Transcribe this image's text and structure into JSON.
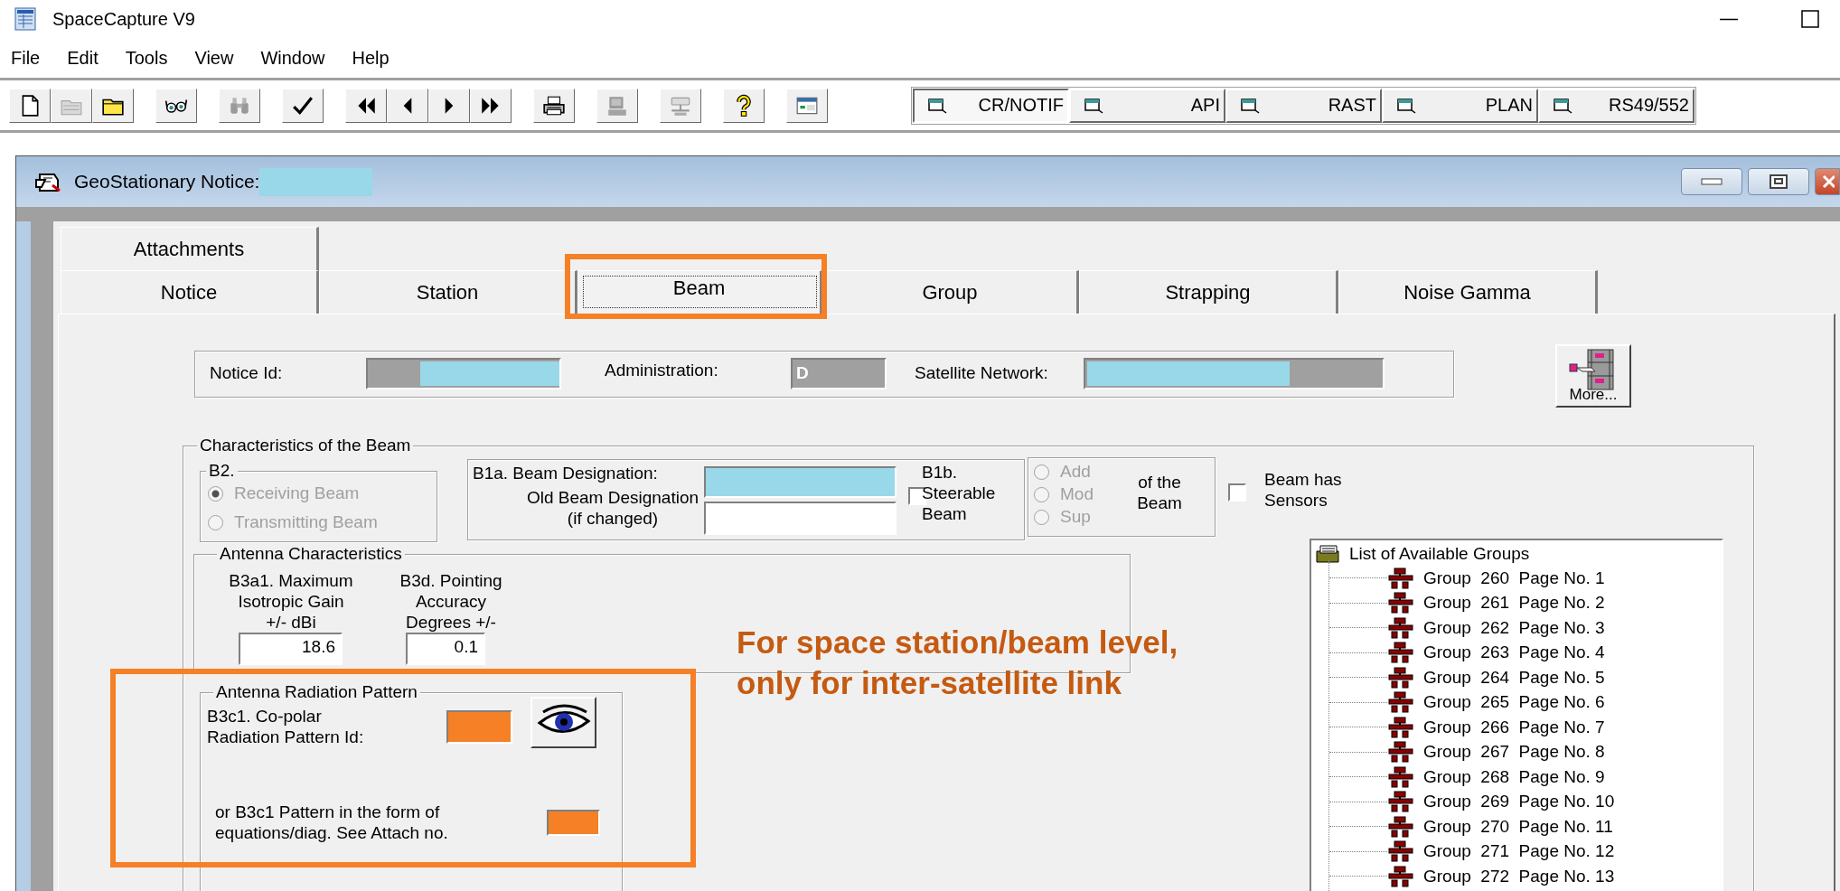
{
  "app": {
    "title": "SpaceCapture V9"
  },
  "menu": [
    {
      "label": "File"
    },
    {
      "label": "Edit"
    },
    {
      "label": "Tools"
    },
    {
      "label": "View"
    },
    {
      "label": "Window"
    },
    {
      "label": "Help"
    }
  ],
  "toolbar": {
    "groups": [
      [
        {
          "kind": "new",
          "disabled": false
        },
        {
          "kind": "open",
          "disabled": true
        },
        {
          "kind": "folder",
          "disabled": false
        }
      ],
      [
        {
          "kind": "glasses",
          "disabled": false
        }
      ],
      [
        {
          "kind": "binoculars",
          "disabled": true
        }
      ],
      [
        {
          "kind": "check",
          "disabled": false
        }
      ],
      [
        {
          "kind": "first",
          "disabled": false
        },
        {
          "kind": "previous",
          "disabled": false
        },
        {
          "kind": "next",
          "disabled": false
        },
        {
          "kind": "last",
          "disabled": false
        }
      ],
      [
        {
          "kind": "print",
          "disabled": false
        }
      ],
      [
        {
          "kind": "computer",
          "disabled": true
        }
      ],
      [
        {
          "kind": "network",
          "disabled": true
        }
      ],
      [
        {
          "kind": "help",
          "disabled": false
        }
      ],
      [
        {
          "kind": "window",
          "disabled": false
        }
      ]
    ]
  },
  "modules": [
    {
      "label": "CR/NOTIF",
      "selected": true
    },
    {
      "label": "API",
      "selected": false
    },
    {
      "label": "RAST",
      "selected": false
    },
    {
      "label": "PLAN",
      "selected": false
    },
    {
      "label": "RS49/552",
      "selected": false
    }
  ],
  "notice_window": {
    "title": "GeoStationary Notice:",
    "title_redacted": true
  },
  "tabs": [
    [
      {
        "label": "Attachments",
        "selected": false
      }
    ],
    [
      {
        "label": "Notice",
        "selected": false
      },
      {
        "label": "Station",
        "selected": false
      },
      {
        "label": "Beam",
        "selected": true
      },
      {
        "label": "Group",
        "selected": false
      },
      {
        "label": "Strapping",
        "selected": false
      },
      {
        "label": "Noise Gamma",
        "selected": false
      }
    ]
  ],
  "header": {
    "notice_id": {
      "label": "Notice Id:",
      "redacted": true
    },
    "administration": {
      "label": "Administration:",
      "value": "D"
    },
    "satellite_network": {
      "label": "Satellite Network:",
      "redacted": true
    },
    "more_button": "More..."
  },
  "beam": {
    "title": "Characteristics of the Beam",
    "b2": {
      "title": "B2.",
      "disabled": true,
      "options": [
        {
          "label": "Receiving Beam",
          "selected": true
        },
        {
          "label": "Transmitting Beam",
          "selected": false
        }
      ]
    },
    "designation": {
      "label": "B1a. Beam Designation:",
      "redacted": true,
      "old_label": [
        "Old Beam Designation",
        "(if changed)"
      ]
    },
    "steerable": {
      "label": [
        "B1b.",
        "Steerable",
        "Beam"
      ],
      "checked": false
    },
    "action": {
      "disabled": true,
      "options": [
        {
          "label": "Add",
          "selected": false
        },
        {
          "label": "Mod",
          "selected": false
        },
        {
          "label": "Sup",
          "selected": false
        }
      ],
      "label": [
        "of the",
        "Beam"
      ]
    },
    "sensors": {
      "label": [
        "Beam has",
        "Sensors"
      ],
      "checked": false
    },
    "antenna": {
      "title": "Antenna Characteristics",
      "fields": [
        {
          "label": [
            "B3a1. Maximum",
            "Isotropic Gain",
            "+/-  dBi"
          ],
          "value": "18.6"
        },
        {
          "label": [
            "B3d. Pointing",
            "Accuracy",
            "Degrees +/-"
          ],
          "value": "0.1"
        }
      ]
    },
    "pattern": {
      "title": "Antenna Radiation Pattern",
      "copolar": {
        "label": [
          "B3c1. Co-polar",
          "Radiation Pattern Id:"
        ],
        "highlighted": true
      },
      "equation": {
        "label": [
          "or B3c1 Pattern in the form of",
          "equations/diag. See Attach no."
        ],
        "highlighted": true
      }
    },
    "groups": {
      "title": "List of Available Groups",
      "items": [
        {
          "label": "Group  260  Page No. 1"
        },
        {
          "label": "Group  261  Page No. 2"
        },
        {
          "label": "Group  262  Page No. 3"
        },
        {
          "label": "Group  263  Page No. 4"
        },
        {
          "label": "Group  264  Page No. 5"
        },
        {
          "label": "Group  265  Page No. 6"
        },
        {
          "label": "Group  266  Page No. 7"
        },
        {
          "label": "Group  267  Page No. 8"
        },
        {
          "label": "Group  268  Page No. 9"
        },
        {
          "label": "Group  269  Page No. 10"
        },
        {
          "label": "Group  270  Page No. 11"
        },
        {
          "label": "Group  271  Page No. 12"
        },
        {
          "label": "Group  272  Page No. 13"
        }
      ]
    }
  },
  "annotations": {
    "note": [
      "For space station/beam level,",
      "only for inter-satellite link"
    ],
    "tab_box": true,
    "pattern_box": true
  }
}
